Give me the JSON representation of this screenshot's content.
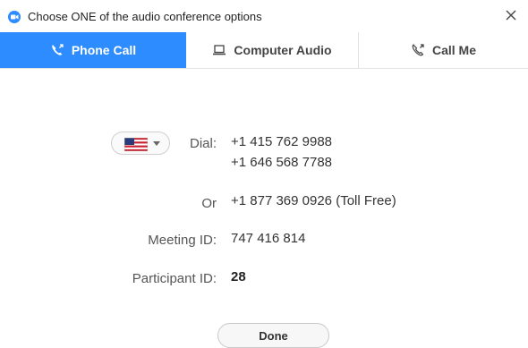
{
  "window": {
    "title": "Choose ONE of the audio conference options",
    "app_icon": "zoom-logo-icon",
    "close_icon": "close-icon"
  },
  "tabs": [
    {
      "label": "Phone Call",
      "icon": "phone-icon",
      "active": true
    },
    {
      "label": "Computer Audio",
      "icon": "laptop-icon",
      "active": false
    },
    {
      "label": "Call Me",
      "icon": "phone-outgoing-icon",
      "active": false
    }
  ],
  "phone": {
    "country_flag": "us-flag-icon",
    "dial_label": "Dial:",
    "dial_numbers": [
      "+1 415 762 9988",
      "+1 646 568 7788"
    ],
    "or_label": "Or",
    "toll_free": "+1 877 369 0926 (Toll Free)",
    "meeting_id_label": "Meeting ID:",
    "meeting_id": "747 416 814",
    "participant_id_label": "Participant ID:",
    "participant_id": "28"
  },
  "actions": {
    "done_label": "Done"
  },
  "colors": {
    "accent": "#2d8cff"
  }
}
